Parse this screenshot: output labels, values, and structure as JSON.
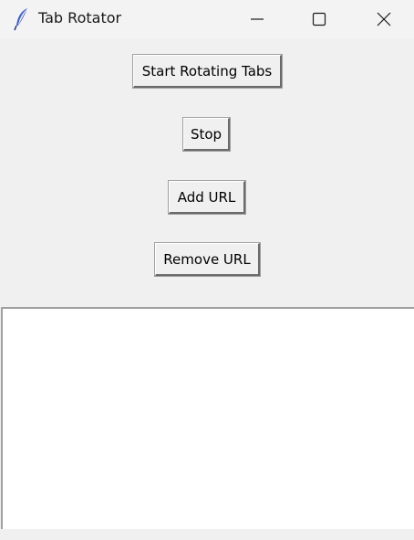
{
  "window": {
    "title": "Tab Rotator",
    "icon": "feather-icon"
  },
  "controls": {
    "start_label": "Start Rotating Tabs",
    "stop_label": "Stop",
    "add_label": "Add URL",
    "remove_label": "Remove URL"
  },
  "url_list": {
    "items": []
  }
}
